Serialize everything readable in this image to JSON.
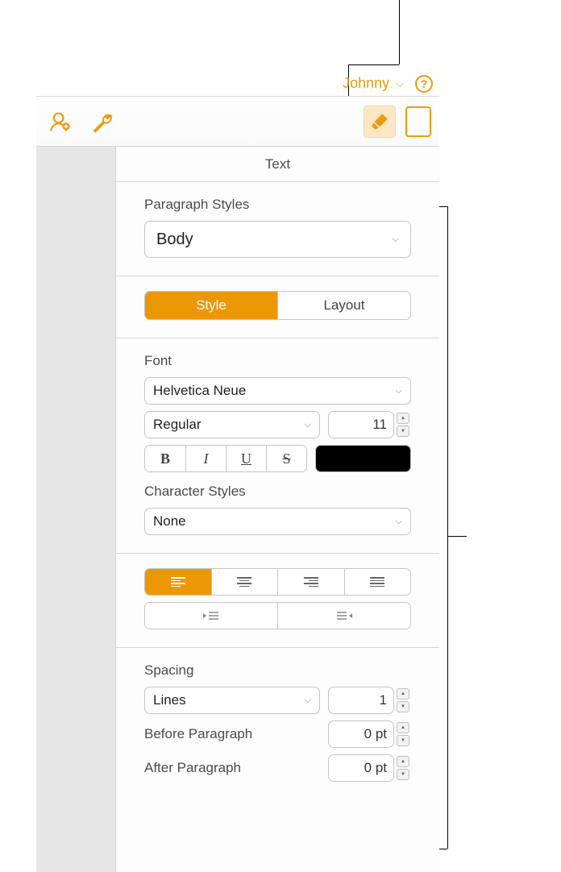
{
  "menubar": {
    "user": "Johnny"
  },
  "inspector": {
    "title": "Text",
    "paragraph_styles": {
      "label": "Paragraph Styles",
      "value": "Body"
    },
    "tabs": {
      "style": "Style",
      "layout": "Layout",
      "active": "style"
    },
    "font": {
      "label": "Font",
      "family": "Helvetica Neue",
      "weight": "Regular",
      "size": "11"
    },
    "buttons": {
      "bold": "B",
      "italic": "I",
      "underline": "U",
      "strike": "S"
    },
    "character_styles": {
      "label": "Character Styles",
      "value": "None"
    },
    "spacing": {
      "label": "Spacing",
      "mode": "Lines",
      "value": "1",
      "before_label": "Before Paragraph",
      "before_value": "0 pt",
      "after_label": "After Paragraph",
      "after_value": "0 pt"
    }
  }
}
